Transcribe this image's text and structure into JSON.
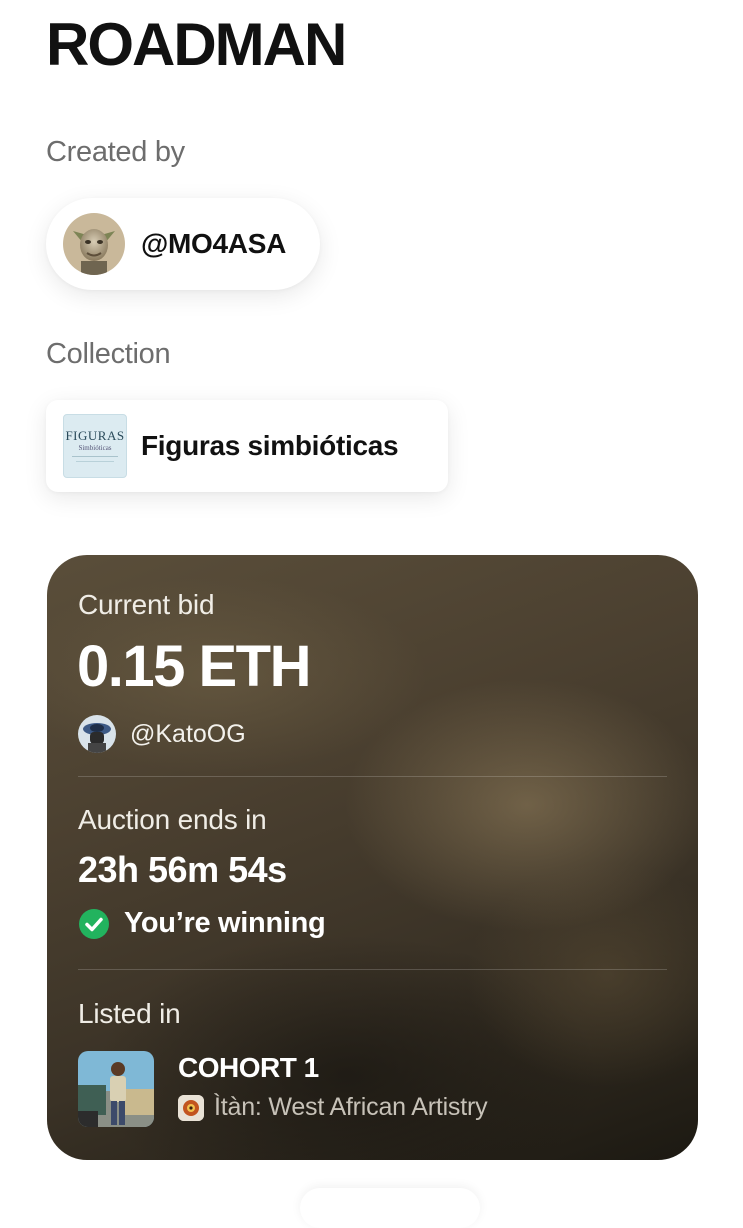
{
  "title": "ROADMAN",
  "created_by": {
    "label": "Created by",
    "username": "@MO4ASA"
  },
  "collection": {
    "label": "Collection",
    "name": "Figuras simbióticas",
    "thumbnail_text": "FIGURAS",
    "thumbnail_subtext": "Simbióticas"
  },
  "auction": {
    "current_bid_label": "Current bid",
    "current_bid": "0.15 ETH",
    "bidder": "@KatoOG",
    "ends_label": "Auction ends in",
    "time_remaining": "23h 56m 54s",
    "status": "You’re winning",
    "listed_label": "Listed in",
    "drop_name": "COHORT 1",
    "drop_subtitle": "Ìtàn: West African Artistry"
  },
  "icons": {
    "status_icon": "check-circle-icon"
  },
  "colors": {
    "status_green": "#22b35e",
    "card_background": "#3f362a"
  }
}
